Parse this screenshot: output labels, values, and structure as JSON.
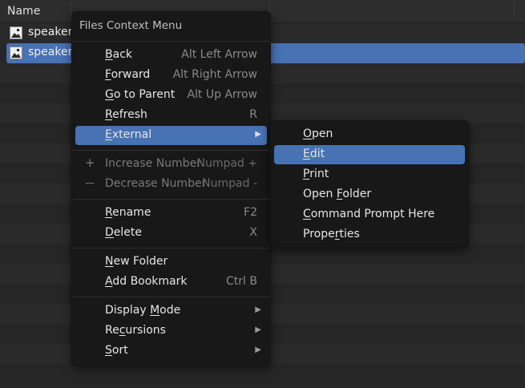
{
  "file_browser": {
    "column_name": "Name",
    "files": [
      {
        "name": "speaker_",
        "selected": false
      },
      {
        "name": "speaker_",
        "selected": true
      }
    ]
  },
  "context_menu": {
    "title": "Files Context Menu",
    "items": {
      "back": {
        "pre": "",
        "u": "B",
        "post": "ack",
        "shortcut": "Alt Left Arrow"
      },
      "forward": {
        "pre": "",
        "u": "F",
        "post": "orward",
        "shortcut": "Alt Right Arrow"
      },
      "go_to_parent": {
        "pre": "",
        "u": "G",
        "post": "o to Parent",
        "shortcut": "Alt Up Arrow"
      },
      "refresh": {
        "pre": "",
        "u": "R",
        "post": "efresh",
        "shortcut": "R"
      },
      "external": {
        "pre": "",
        "u": "E",
        "post": "xternal",
        "arrow": "▶"
      },
      "increase_number": {
        "lead": "+",
        "label": "Increase Number",
        "shortcut": "Numpad +"
      },
      "decrease_number": {
        "lead": "—",
        "label": "Decrease Number",
        "shortcut": "Numpad -"
      },
      "rename": {
        "pre": "",
        "u": "R",
        "post": "ename",
        "shortcut": "F2"
      },
      "delete": {
        "pre": "",
        "u": "D",
        "post": "elete",
        "shortcut": "X"
      },
      "new_folder": {
        "pre": "",
        "u": "N",
        "post": "ew Folder"
      },
      "add_bookmark": {
        "pre": "",
        "u": "A",
        "post": "dd Bookmark",
        "shortcut": "Ctrl B"
      },
      "display_mode": {
        "pre": "Display ",
        "u": "M",
        "post": "ode",
        "arrow": "▶"
      },
      "recursions": {
        "pre": "Re",
        "u": "c",
        "post": "ursions",
        "arrow": "▶"
      },
      "sort": {
        "pre": "",
        "u": "S",
        "post": "ort",
        "arrow": "▶"
      }
    }
  },
  "external_submenu": {
    "items": {
      "open": {
        "pre": "",
        "u": "O",
        "post": "pen"
      },
      "edit": {
        "pre": "",
        "u": "E",
        "post": "dit"
      },
      "print": {
        "pre": "",
        "u": "P",
        "post": "rint"
      },
      "open_folder": {
        "pre": "Open ",
        "u": "F",
        "post": "older"
      },
      "command_prompt": {
        "pre": "",
        "u": "C",
        "post": "ommand Prompt Here"
      },
      "properties": {
        "pre": "Prope",
        "u": "r",
        "post": "ties"
      }
    }
  },
  "colors": {
    "highlight": "#4772b3",
    "menu_bg": "#181818",
    "editor_bg": "#282828"
  }
}
